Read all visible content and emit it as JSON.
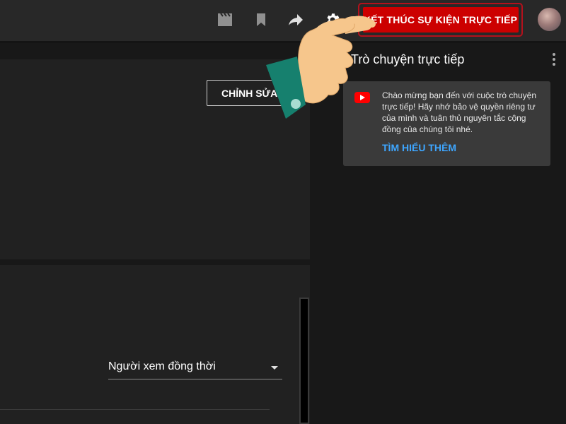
{
  "topbar": {
    "icons": [
      "clapperboard-icon",
      "bookmark-icon",
      "share-icon",
      "gear-icon"
    ],
    "end_event_label": "KẾT THÚC SỰ KIỆN TRỰC TIẾP",
    "accent_color": "#cc0000"
  },
  "stream_panel": {
    "edit_label": "CHỈNH SỬA"
  },
  "analytics_panel": {
    "viewer_select_label": "Người xem đồng thời"
  },
  "chat": {
    "title": "Trò chuyện trực tiếp",
    "welcome_message": "Chào mừng bạn đến với cuộc trò chuyện trực tiếp! Hãy nhớ bảo vệ quyền riêng tư của mình và tuân thủ nguyên tắc cộng đồng của chúng tôi nhé.",
    "learn_more_label": "TÌM HIỂU THÊM",
    "link_color": "#3ea6ff"
  }
}
